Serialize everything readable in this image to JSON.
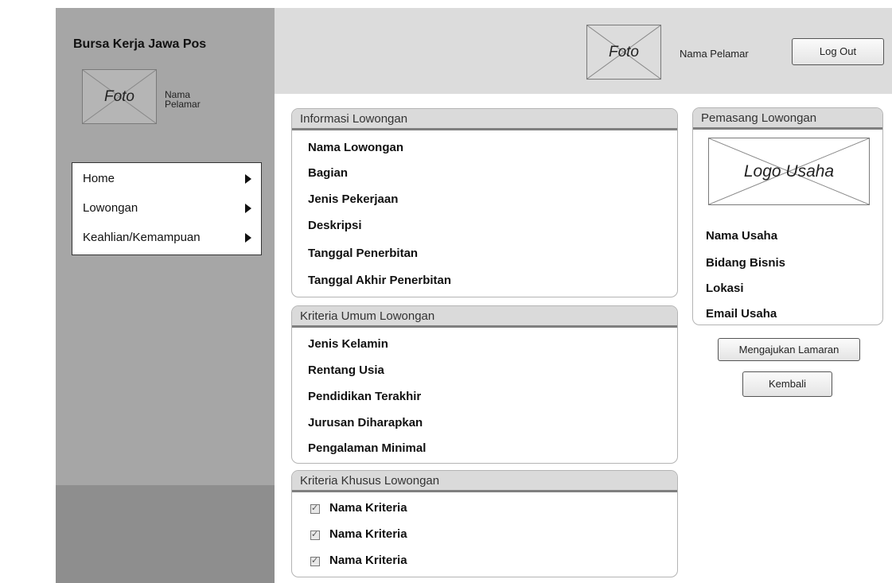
{
  "app": {
    "title": "Bursa Kerja Jawa Pos"
  },
  "sidebar": {
    "photo_label": "Foto",
    "user_name": "Nama Pelamar",
    "menu": [
      {
        "label": "Home"
      },
      {
        "label": "Lowongan"
      },
      {
        "label": "Keahlian/Kemampuan"
      }
    ]
  },
  "header": {
    "photo_label": "Foto",
    "user_name": "Nama Pelamar",
    "logout_label": "Log Out"
  },
  "informasi_lowongan": {
    "title": "Informasi Lowongan",
    "fields": [
      "Nama Lowongan",
      "Bagian",
      "Jenis Pekerjaan",
      "Deskripsi",
      "Tanggal Penerbitan",
      "Tanggal Akhir Penerbitan"
    ]
  },
  "kriteria_umum": {
    "title": "Kriteria Umum Lowongan",
    "fields": [
      "Jenis Kelamin",
      "Rentang Usia",
      "Pendidikan Terakhir",
      "Jurusan Diharapkan",
      "Pengalaman Minimal"
    ]
  },
  "kriteria_khusus": {
    "title": "Kriteria Khusus Lowongan",
    "items": [
      {
        "label": "Nama Kriteria",
        "checked": true
      },
      {
        "label": "Nama Kriteria",
        "checked": true
      },
      {
        "label": "Nama Kriteria",
        "checked": true
      }
    ]
  },
  "pemasang_lowongan": {
    "title": "Pemasang Lowongan",
    "logo_label": "Logo Usaha",
    "fields": [
      "Nama Usaha",
      "Bidang Bisnis",
      "Lokasi",
      "Email Usaha"
    ]
  },
  "actions": {
    "apply_label": "Mengajukan Lamaran",
    "back_label": "Kembali"
  }
}
